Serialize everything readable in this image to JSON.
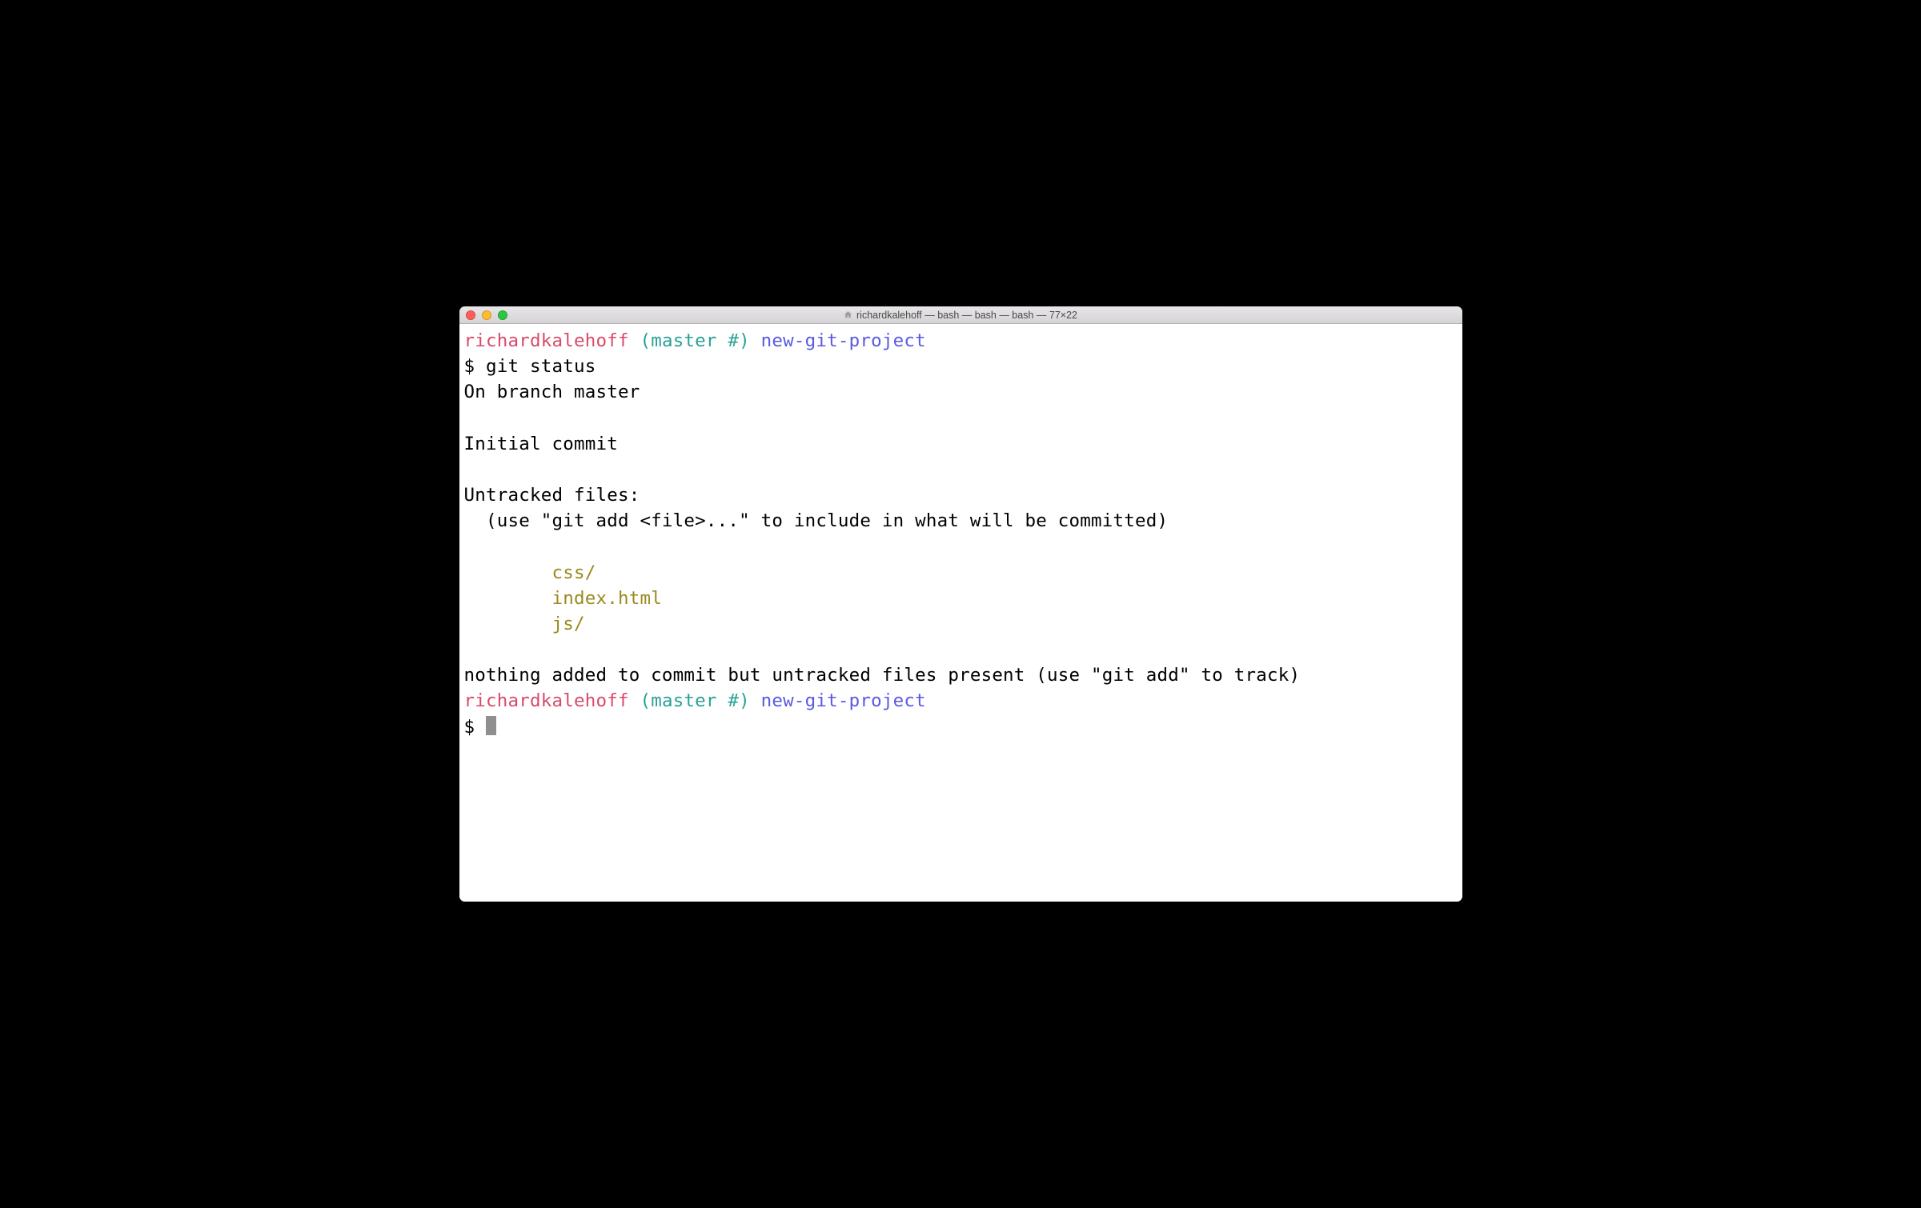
{
  "window": {
    "title": "richardkalehoff — bash — bash — bash — 77×22"
  },
  "prompt1": {
    "user": "richardkalehoff",
    "branch": "(master #)",
    "dir": "new-git-project"
  },
  "cmd1": {
    "ps1": "$ ",
    "text": "git status"
  },
  "out": {
    "l1": "On branch master",
    "l2": "",
    "l3": "Initial commit",
    "l4": "",
    "l5": "Untracked files:",
    "l6": "  (use \"git add <file>...\" to include in what will be committed)",
    "l7": "",
    "indent": "        ",
    "u1": "css/",
    "u2": "index.html",
    "u3": "js/",
    "l8": "",
    "l9": "nothing added to commit but untracked files present (use \"git add\" to track)"
  },
  "prompt2": {
    "user": "richardkalehoff",
    "branch": "(master #)",
    "dir": "new-git-project"
  },
  "cmd2": {
    "ps1": "$ "
  }
}
